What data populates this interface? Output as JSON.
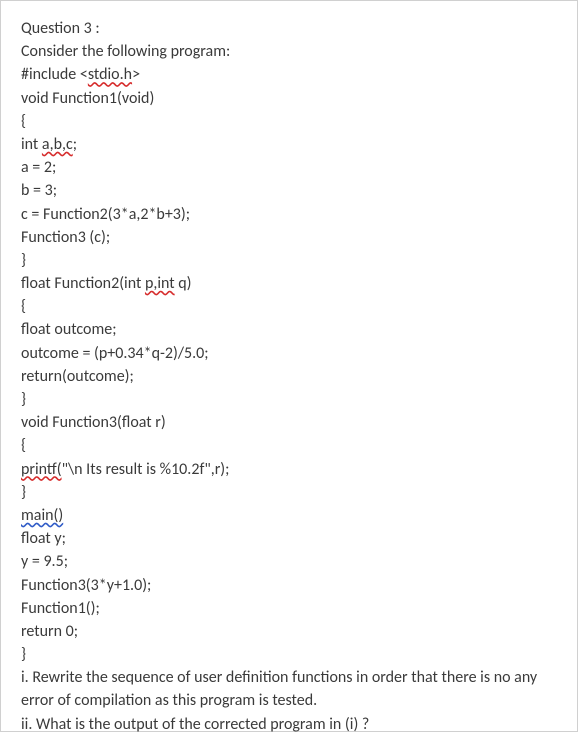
{
  "question_title": "Question 3 :",
  "intro": "Consider the following program:",
  "code": {
    "include_pre": "#include <",
    "include_squig": "stdio.h",
    "include_post": ">",
    "fn1_sig": "void Function1(void)",
    "brace_open": "{",
    "int_decl_pre": "int ",
    "int_decl_squig": "a,b,c",
    "int_decl_post": ";",
    "a_assign": "a = 2;",
    "b_assign": "b = 3;",
    "c_assign": "c = Function2(3*a,2*b+3);",
    "fn3_call1": "Function3 (c);",
    "brace_close": "}",
    "fn2_sig_pre": "float Function2(int ",
    "fn2_sig_squig": "p,int",
    "fn2_sig_post": " q)",
    "outcome_decl": "float outcome;",
    "outcome_assign": "outcome = (p+0.34*q-2)/5.0;",
    "return_outcome": "return(outcome);",
    "fn3_sig": "void Function3(float r)",
    "printf_squig": "printf(",
    "printf_rest": "\"\\n Its result is %10.2f\",r);",
    "main_squig": "main()",
    "float_y": "float y;",
    "y_assign": "y = 9.5;",
    "fn3_call2": "Function3(3*y+1.0);",
    "fn1_call": "Function1();",
    "return0": "return 0;"
  },
  "q_i": "i. Rewrite the sequence of user definition functions in order that there is no any error of compilation as this program is tested.",
  "q_ii": "ii. What is the output of the corrected program in (i) ?"
}
